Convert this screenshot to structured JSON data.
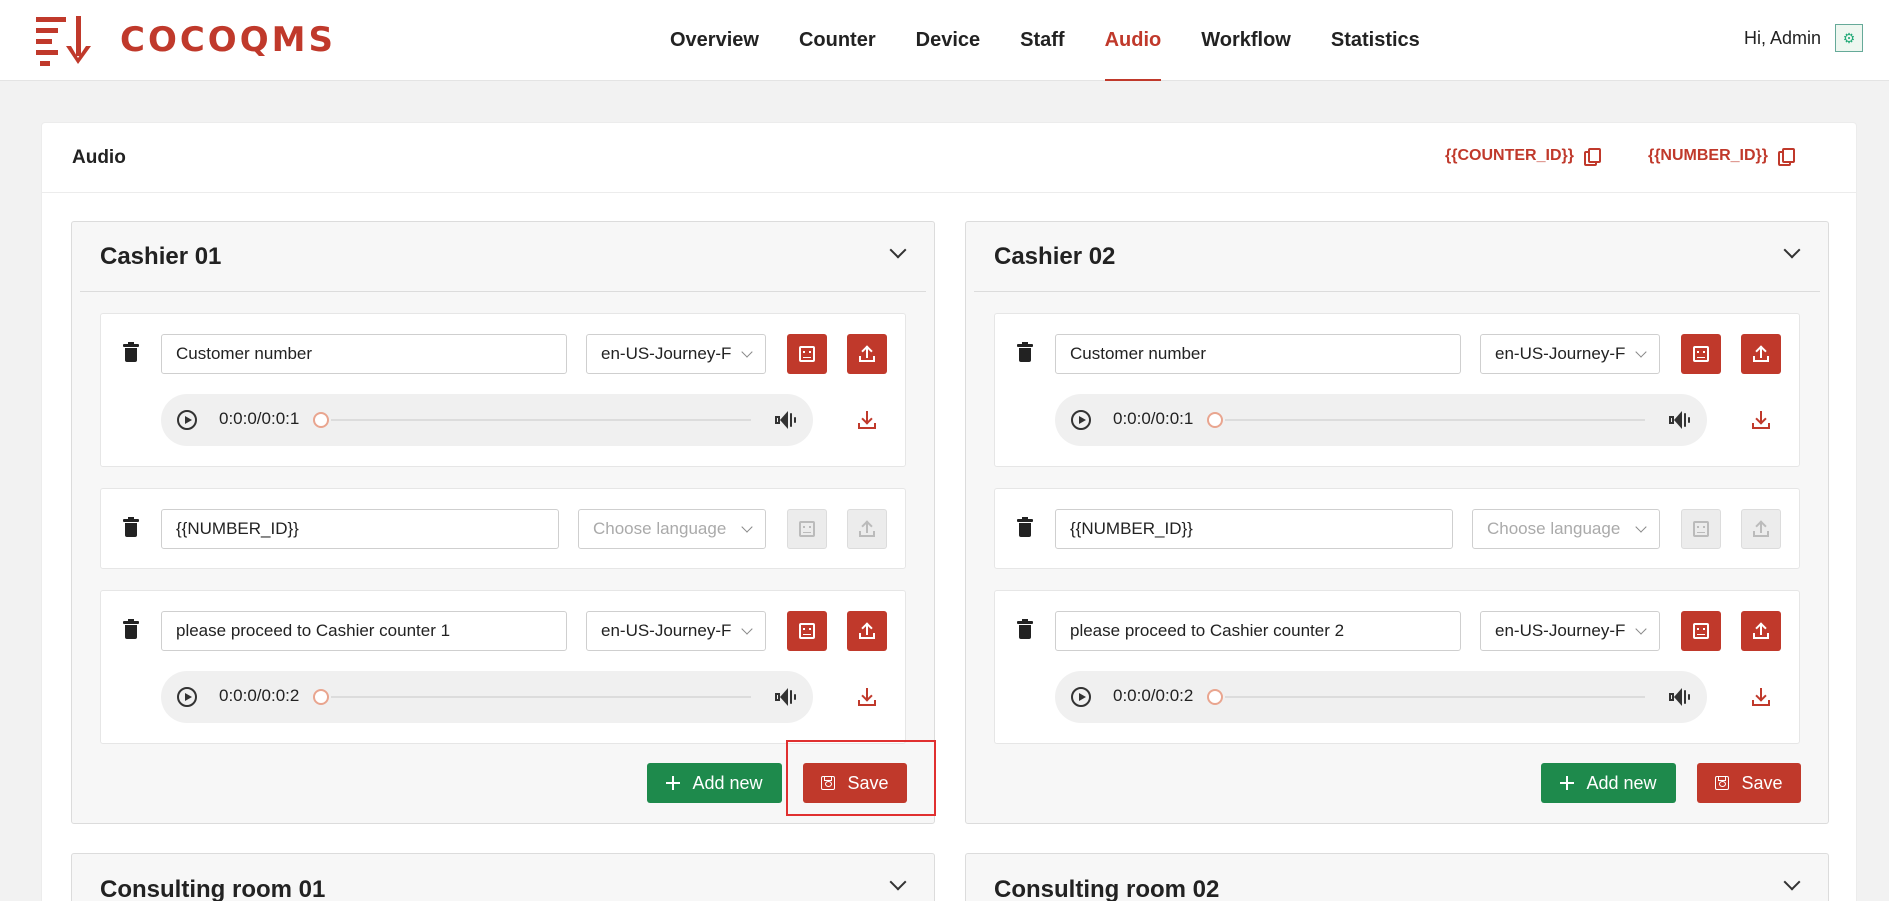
{
  "brand": {
    "name": "COCOQMS",
    "color": "#c0392b"
  },
  "nav": {
    "items": [
      "Overview",
      "Counter",
      "Device",
      "Staff",
      "Audio",
      "Workflow",
      "Statistics"
    ],
    "active": "Audio"
  },
  "user": {
    "greeting": "Hi, Admin",
    "avatar_icon": "avatar-icon"
  },
  "page": {
    "title": "Audio",
    "variables": [
      "{{COUNTER_ID}}",
      "{{NUMBER_ID}}"
    ]
  },
  "panels": [
    {
      "title": "Cashier 01",
      "items": [
        {
          "text": "Customer number",
          "language": "en-US-Journey-F",
          "time": "0:0:0/0:0:1"
        },
        {
          "text": "{{NUMBER_ID}}",
          "language_placeholder": "Choose language"
        },
        {
          "text": "please proceed to Cashier counter 1",
          "language": "en-US-Journey-F",
          "time": "0:0:0/0:0:2"
        }
      ],
      "add_label": "Add new",
      "save_label": "Save"
    },
    {
      "title": "Cashier 02",
      "items": [
        {
          "text": "Customer number",
          "language": "en-US-Journey-F",
          "time": "0:0:0/0:0:1"
        },
        {
          "text": "{{NUMBER_ID}}",
          "language_placeholder": "Choose language"
        },
        {
          "text": "please proceed to Cashier counter 2",
          "language": "en-US-Journey-F",
          "time": "0:0:0/0:0:2"
        }
      ],
      "add_label": "Add new",
      "save_label": "Save"
    },
    {
      "title": "Consulting room 01"
    },
    {
      "title": "Consulting room 02"
    }
  ],
  "colors": {
    "accent": "#c0392b",
    "success": "#1e8a4c"
  }
}
